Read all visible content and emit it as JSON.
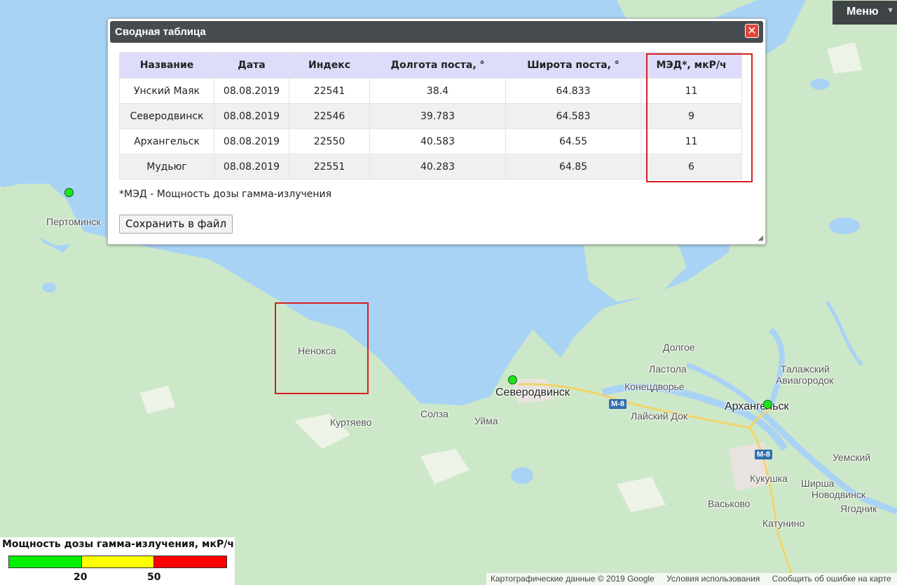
{
  "menu": {
    "label": "Меню"
  },
  "dialog": {
    "title": "Сводная таблица",
    "columns": [
      "Название",
      "Дата",
      "Индекс",
      "Долгота поста, °",
      "Широта поста, °",
      "МЭД*, мкР/ч"
    ],
    "rows": [
      [
        "Унский Маяк",
        "08.08.2019",
        "22541",
        "38.4",
        "64.833",
        "11"
      ],
      [
        "Северодвинск",
        "08.08.2019",
        "22546",
        "39.783",
        "64.583",
        "9"
      ],
      [
        "Архангельск",
        "08.08.2019",
        "22550",
        "40.583",
        "64.55",
        "11"
      ],
      [
        "Мудьюг",
        "08.08.2019",
        "22551",
        "40.283",
        "64.85",
        "6"
      ]
    ],
    "footnote": "*МЭД - Мощность дозы гамма-излучения",
    "save_label": "Сохранить в файл",
    "close_glyph": "✕"
  },
  "map": {
    "places": {
      "pertominsk": "Пертоминск",
      "nenoksa": "Ненокса",
      "kurtyaevo": "Куртяево",
      "solza": "Солза",
      "uima": "Уйма",
      "severodvinsk": "Северодвинск",
      "dolgoe": "Долгое",
      "lastola": "Ластола",
      "konetsdvorye": "Конецдворье",
      "laisky_dok": "Лайский Док",
      "talazhsky": "Талажский",
      "aviagorodok": "Авиагородок",
      "arkhangelsk": "Архангельск",
      "yemsky": "Уемский",
      "kukushka": "Кукушка",
      "shirsha": "Ширша",
      "novodvinsk": "Новодвинск",
      "yagodnik": "Ягодник",
      "vaskovo": "Васьково",
      "katunino": "Катунино"
    },
    "highway_label_1": "M-8",
    "highway_label_2": "M-8",
    "colors": {
      "sea": "#a9d3f5",
      "land": "#cde8c8",
      "marker": "#19e619"
    }
  },
  "legend": {
    "title": "Мощность дозы гамма-излучения, мкР/ч",
    "threshold_low": "20",
    "threshold_high": "50",
    "colors": {
      "low": "#00ee00",
      "mid": "#ffff00",
      "high": "#ff0000"
    }
  },
  "attribution": {
    "map_data": "Картографические данные © 2019 Google",
    "terms": "Условия использования",
    "report": "Сообщить об ошибке на карте"
  }
}
